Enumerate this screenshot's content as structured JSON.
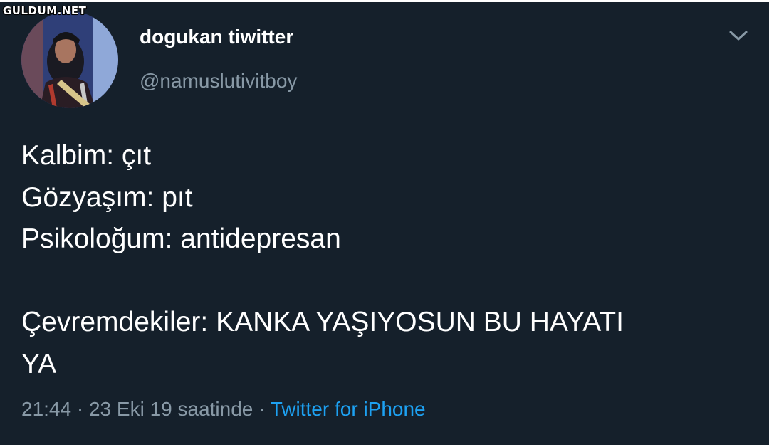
{
  "watermark": "GULDUM.NET",
  "user": {
    "display_name": "dogukan tiwitter",
    "handle": "@namuslutivitboy"
  },
  "tweet": {
    "lines": [
      "Kalbim: çıt",
      "Gözyaşım: pıt",
      "Psikoloğum: antidepresan",
      "",
      "Çevremdekiler: KANKA YAŞIYOSUN BU HAYATI",
      "YA"
    ]
  },
  "meta": {
    "time": "21:44",
    "separator": " · ",
    "date": "23 Eki 19 saatinde",
    "source": "Twitter for iPhone"
  },
  "icons": {
    "menu": "chevron-down-icon"
  },
  "colors": {
    "background": "#15202b",
    "text": "#ffffff",
    "secondary": "#8899a6",
    "link": "#1da1f2"
  }
}
